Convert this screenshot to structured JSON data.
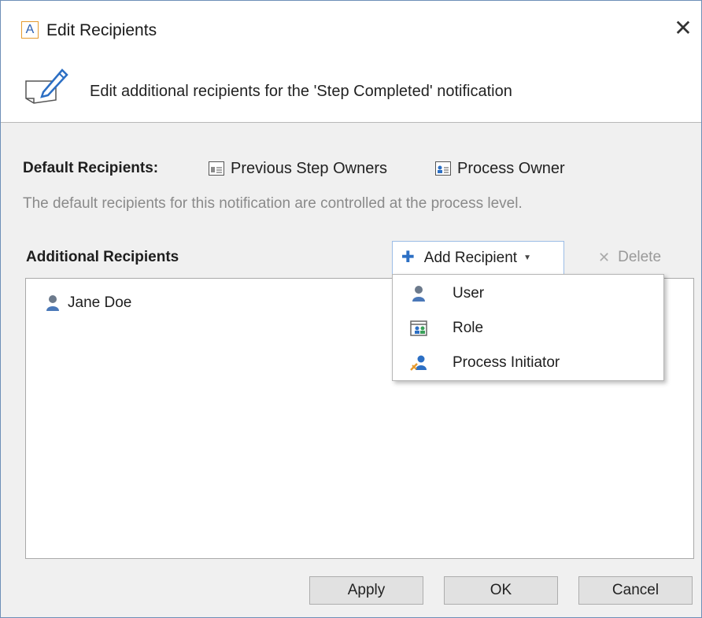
{
  "window": {
    "title": "Edit Recipients",
    "app_icon_letter": "A",
    "close_glyph": "✕"
  },
  "header": {
    "text": "Edit additional recipients for the 'Step Completed' notification"
  },
  "default_recipients": {
    "label": "Default Recipients:",
    "items": [
      "Previous Step Owners",
      "Process Owner"
    ],
    "note": "The default recipients for this notification are controlled at the process level."
  },
  "additional": {
    "label": "Additional Recipients",
    "items": [
      "Jane Doe"
    ]
  },
  "toolbar": {
    "add_label": "Add Recipient",
    "add_glyph": "✚",
    "caret": "▼",
    "delete_label": "Delete",
    "delete_glyph": "✕"
  },
  "menu": {
    "items": [
      "User",
      "Role",
      "Process Initiator"
    ]
  },
  "buttons": {
    "apply": "Apply",
    "ok": "OK",
    "cancel": "Cancel"
  },
  "colors": {
    "accent": "#2c6fc4",
    "menu_border": "#9cbde6",
    "icon_orange": "#e69a2e"
  }
}
